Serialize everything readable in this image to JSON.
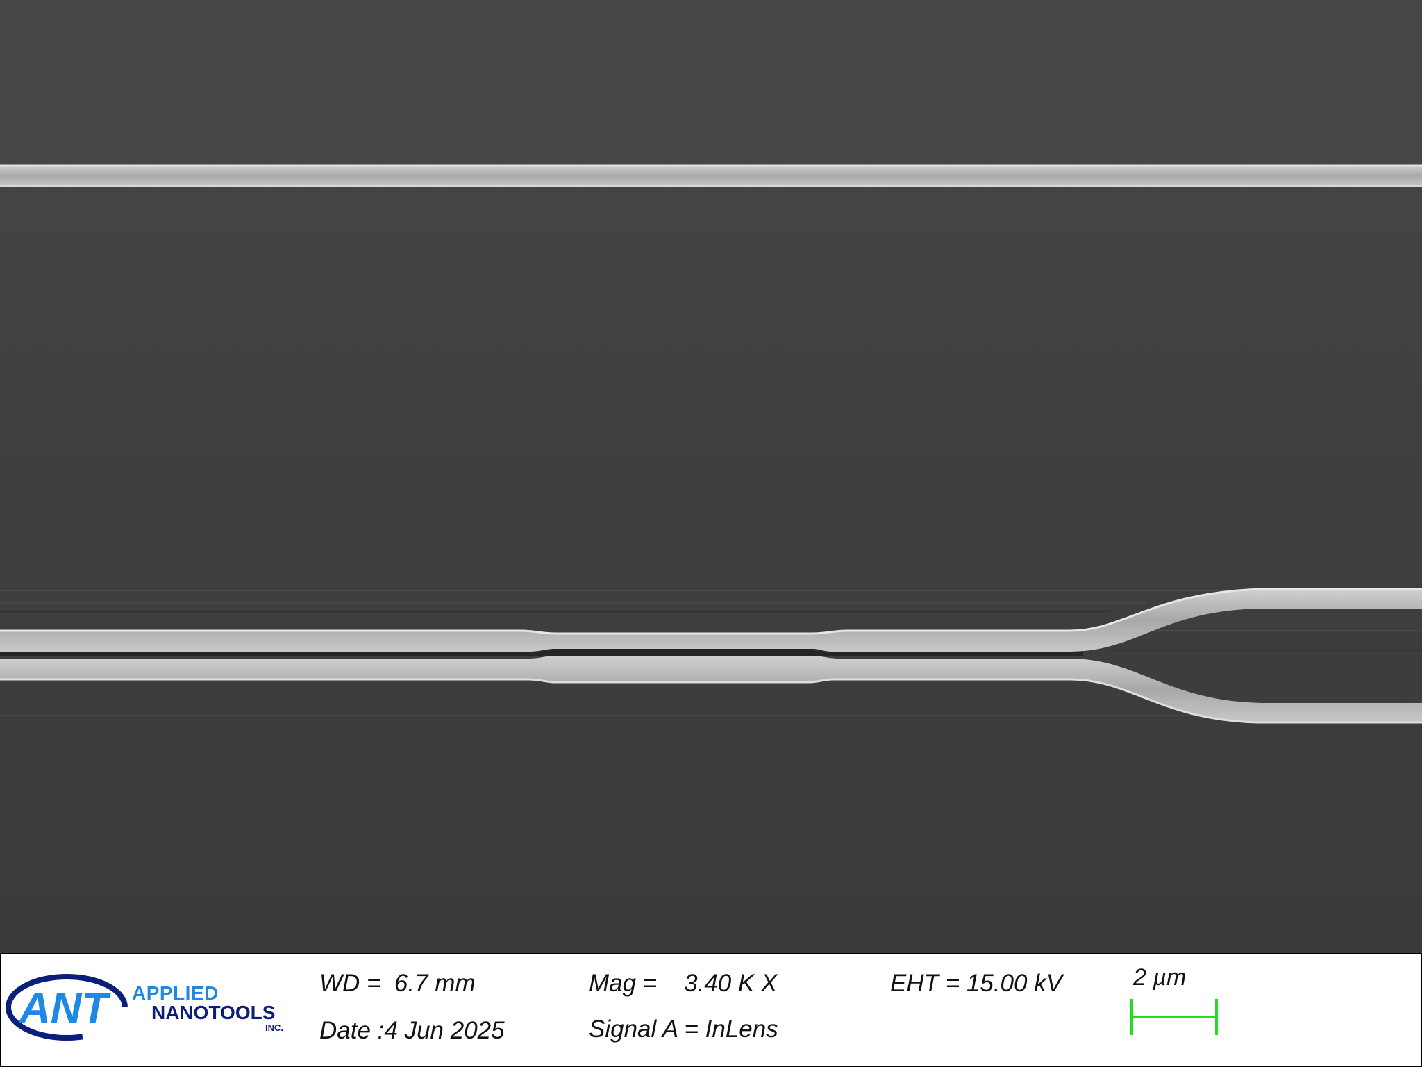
{
  "image": {
    "type": "SEM micrograph",
    "subject": "silicon waveguide directional coupler",
    "colors": {
      "background": "#3d3d3d",
      "waveguide": "#b8b8b8",
      "scale_bar": "#22dd22",
      "info_bar": "#ffffff",
      "logo_light_blue": "#1e88e5",
      "logo_dark_blue": "#0b1f7a"
    }
  },
  "info_bar": {
    "logo": {
      "mark": "ANT",
      "line1": "APPLIED",
      "line2": "NANOTOOLS",
      "line3": "INC."
    },
    "wd": "WD =  6.7 mm",
    "date": "Date :4 Jun 2025",
    "mag": "Mag =    3.40 K X",
    "signal": "Signal A = InLens",
    "eht": "EHT = 15.00 kV",
    "scale_label": "2 µm"
  }
}
